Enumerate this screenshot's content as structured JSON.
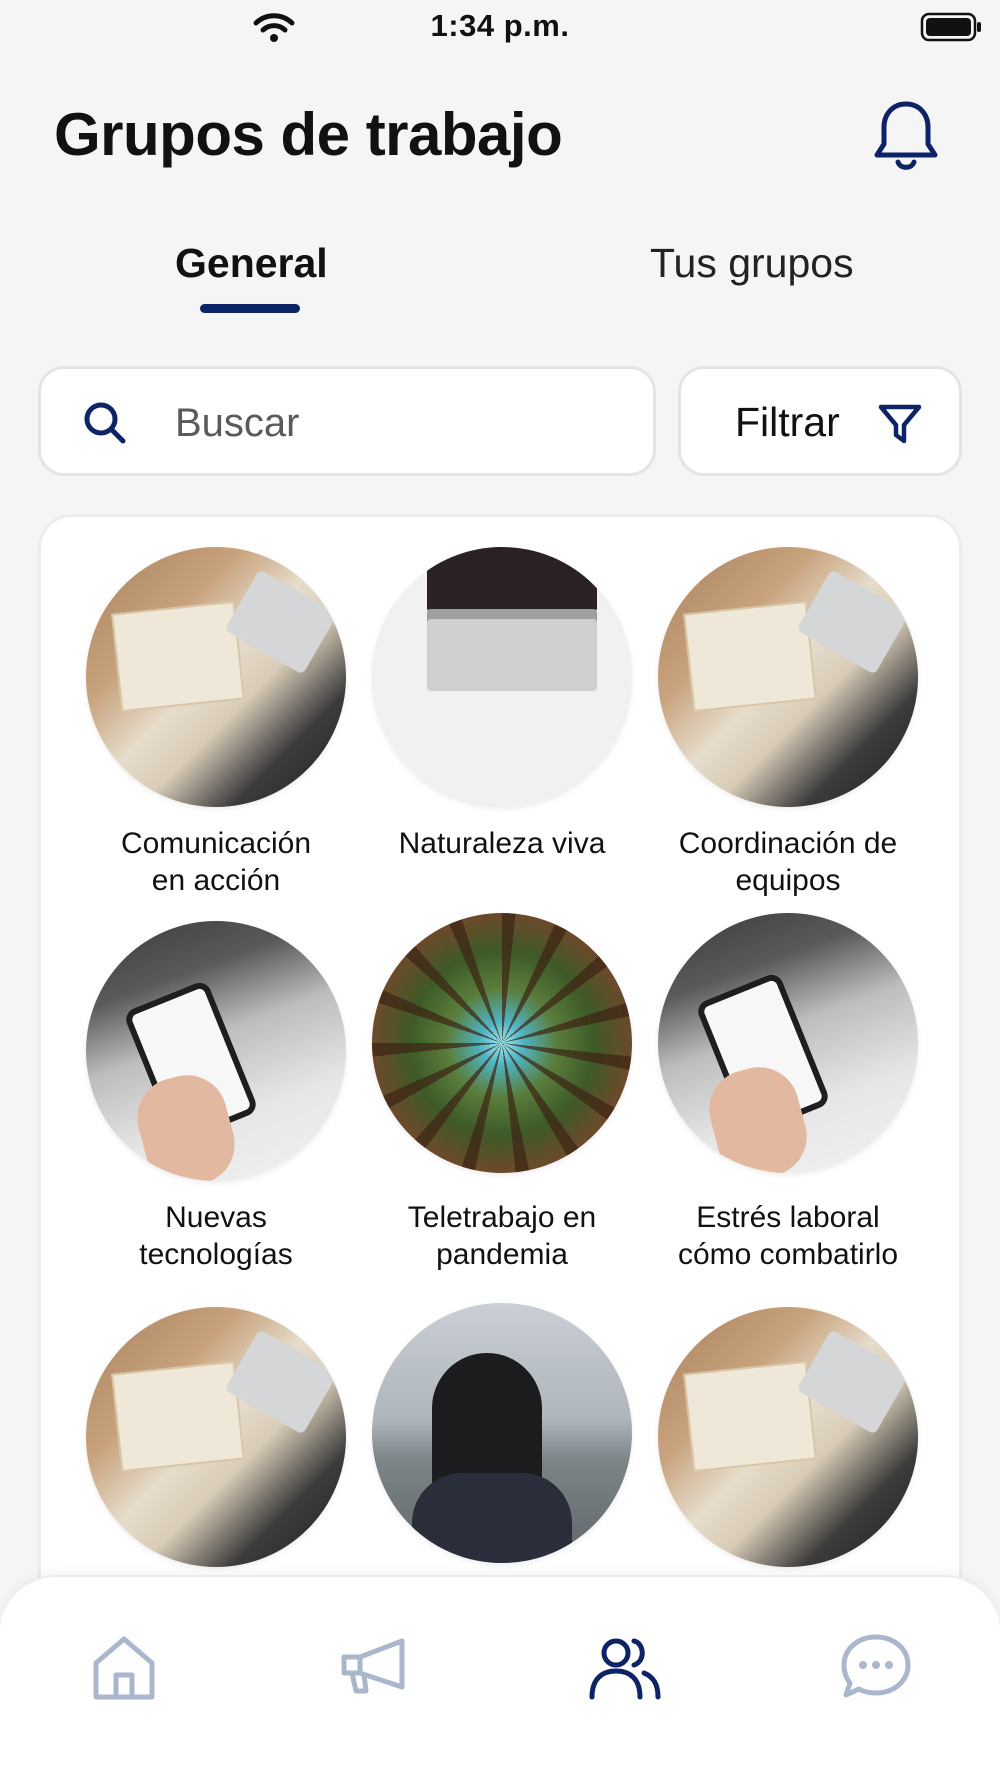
{
  "status_bar": {
    "time": "1:34 p.m."
  },
  "header": {
    "title": "Grupos de trabajo"
  },
  "tabs": [
    {
      "label": "General",
      "active": true
    },
    {
      "label": "Tus grupos",
      "active": false
    }
  ],
  "search": {
    "placeholder": "Buscar",
    "value": ""
  },
  "filter": {
    "label": "Filtrar"
  },
  "groups": [
    {
      "label_lines": [
        "Comunicación",
        "en acción"
      ],
      "image": "desk"
    },
    {
      "label_lines": [
        "Naturaleza viva",
        ""
      ],
      "image": "laptop"
    },
    {
      "label_lines": [
        "Coordinación de",
        "equipos"
      ],
      "image": "desk"
    },
    {
      "label_lines": [
        "Nuevas",
        "tecnologías"
      ],
      "image": "phone"
    },
    {
      "label_lines": [
        "Teletrabajo  en",
        "pandemia"
      ],
      "image": "forest"
    },
    {
      "label_lines": [
        "Estrés laboral",
        "cómo combatirlo"
      ],
      "image": "phone"
    },
    {
      "label_lines": [
        "",
        ""
      ],
      "image": "desk"
    },
    {
      "label_lines": [
        "",
        ""
      ],
      "image": "woman"
    },
    {
      "label_lines": [
        "",
        ""
      ],
      "image": "desk"
    }
  ],
  "bottom_nav": [
    {
      "name": "home",
      "icon": "home-icon",
      "active": false
    },
    {
      "name": "announcements",
      "icon": "megaphone-icon",
      "active": false
    },
    {
      "name": "groups",
      "icon": "users-icon",
      "active": true
    },
    {
      "name": "chat",
      "icon": "chat-bubble-icon",
      "active": false
    }
  ],
  "colors": {
    "accent": "#0d2366",
    "inactive_icon": "#a9b6cc",
    "background": "#f5f5f5"
  }
}
